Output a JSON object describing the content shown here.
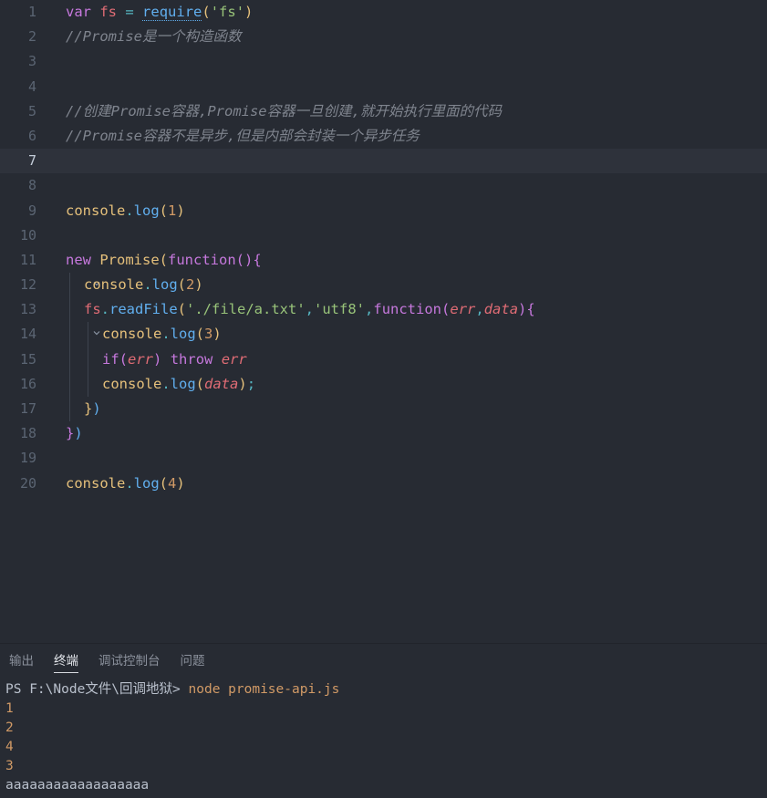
{
  "editor": {
    "name": "code-editor",
    "language": "javascript",
    "lines": [
      {
        "n": "1",
        "fold": "",
        "indent": 0
      },
      {
        "n": "2",
        "fold": "",
        "indent": 0
      },
      {
        "n": "3",
        "fold": "",
        "indent": 0
      },
      {
        "n": "4",
        "fold": "",
        "indent": 0
      },
      {
        "n": "5",
        "fold": "",
        "indent": 0
      },
      {
        "n": "6",
        "fold": "",
        "indent": 0
      },
      {
        "n": "7",
        "fold": "",
        "indent": 0
      },
      {
        "n": "8",
        "fold": "",
        "indent": 0
      },
      {
        "n": "9",
        "fold": "",
        "indent": 0
      },
      {
        "n": "10",
        "fold": "",
        "indent": 0
      },
      {
        "n": "11",
        "fold": "v",
        "indent": 0
      },
      {
        "n": "12",
        "fold": "",
        "indent": 1
      },
      {
        "n": "13",
        "fold": "v",
        "indent": 1
      },
      {
        "n": "14",
        "fold": "",
        "indent": 2
      },
      {
        "n": "15",
        "fold": "",
        "indent": 2
      },
      {
        "n": "16",
        "fold": "",
        "indent": 2
      },
      {
        "n": "17",
        "fold": "",
        "indent": 1
      },
      {
        "n": "18",
        "fold": "",
        "indent": 0
      },
      {
        "n": "19",
        "fold": "",
        "indent": 0
      },
      {
        "n": "20",
        "fold": "",
        "indent": 0
      }
    ],
    "active_line": 7,
    "source_text": [
      "var fs = require('fs')",
      "//Promise是一个构造函数",
      "",
      "",
      "//创建Promise容器,Promise容器一旦创建,就开始执行里面的代码",
      "//Promise容器不是异步,但是内部会封装一个异步任务",
      "",
      "",
      "console.log(1)",
      "",
      "new Promise(function(){",
      "  console.log(2)",
      "  fs.readFile('./file/a.txt','utf8',function(err,data){",
      "    console.log(3)",
      "    if(err) throw err",
      "    console.log(data);",
      "  })",
      "})",
      "",
      "console.log(4)"
    ],
    "tokens": {
      "l1": {
        "kw_var": "var",
        "ident_fs": "fs",
        "op_eq": "=",
        "fn_require": "require",
        "paren_open": "(",
        "str_fs": "'fs'",
        "paren_close": ")"
      },
      "l2": {
        "comment": "//Promise是一个构造函数"
      },
      "l5": {
        "comment": "//创建Promise容器,Promise容器一旦创建,就开始执行里面的代码"
      },
      "l6": {
        "comment": "//Promise容器不是异步,但是内部会封装一个异步任务"
      },
      "l9": {
        "obj": "console",
        "dot": ".",
        "fn": "log",
        "paren_open": "(",
        "num": "1",
        "paren_close": ")"
      },
      "l11": {
        "kw_new": "new",
        "cls": "Promise",
        "paren_open": "(",
        "kw_function": "function",
        "p2_open": "(",
        "p2_close": ")",
        "brace_open": "{"
      },
      "l12": {
        "obj": "console",
        "dot": ".",
        "fn": "log",
        "paren_open": "(",
        "num": "2",
        "paren_close": ")"
      },
      "l13": {
        "ident_fs": "fs",
        "dot": ".",
        "fn": "readFile",
        "paren_open": "(",
        "str_path": "'./file/a.txt'",
        "comma1": ",",
        "str_enc": "'utf8'",
        "comma2": ",",
        "kw_function": "function",
        "p2_open": "(",
        "arg_err": "err",
        "comma3": ",",
        "arg_data": "data",
        "p2_close": ")",
        "brace_open": "{"
      },
      "l14": {
        "obj": "console",
        "dot": ".",
        "fn": "log",
        "paren_open": "(",
        "num": "3",
        "paren_close": ")"
      },
      "l15": {
        "kw_if": "if",
        "paren_open": "(",
        "arg_err": "err",
        "paren_close": ")",
        "kw_throw": "throw",
        "ident_err": "err"
      },
      "l16": {
        "obj": "console",
        "dot": ".",
        "fn": "log",
        "paren_open": "(",
        "arg_data": "data",
        "paren_close": ")",
        "semi": ";"
      },
      "l17": {
        "brace_close": "}",
        "paren_close": ")"
      },
      "l18": {
        "brace_close": "}",
        "paren_close": ")"
      },
      "l20": {
        "obj": "console",
        "dot": ".",
        "fn": "log",
        "paren_open": "(",
        "num": "4",
        "paren_close": ")"
      }
    }
  },
  "panel": {
    "tabs": [
      {
        "label": "输出",
        "active": false
      },
      {
        "label": "终端",
        "active": true
      },
      {
        "label": "调试控制台",
        "active": false
      },
      {
        "label": "问题",
        "active": false
      }
    ],
    "terminal": {
      "prompt": "PS F:\\Node文件\\回调地狱>",
      "command": "node promise-api.js",
      "output": [
        "1",
        "2",
        "4",
        "3",
        "aaaaaaaaaaaaaaaaaa"
      ]
    }
  },
  "colors": {
    "editor_bg": "#272b33",
    "active_line_bg": "#2e323b",
    "line_number": "#5b6573",
    "keyword": "#c678dd",
    "variable": "#e06c75",
    "function": "#61afef",
    "string": "#98c379",
    "number": "#d19a66",
    "object": "#e5c07b",
    "comment": "#7f848e",
    "operator": "#56b6c2",
    "panel_text": "#b9c0cc",
    "tab_active": "#e3e6eb"
  }
}
